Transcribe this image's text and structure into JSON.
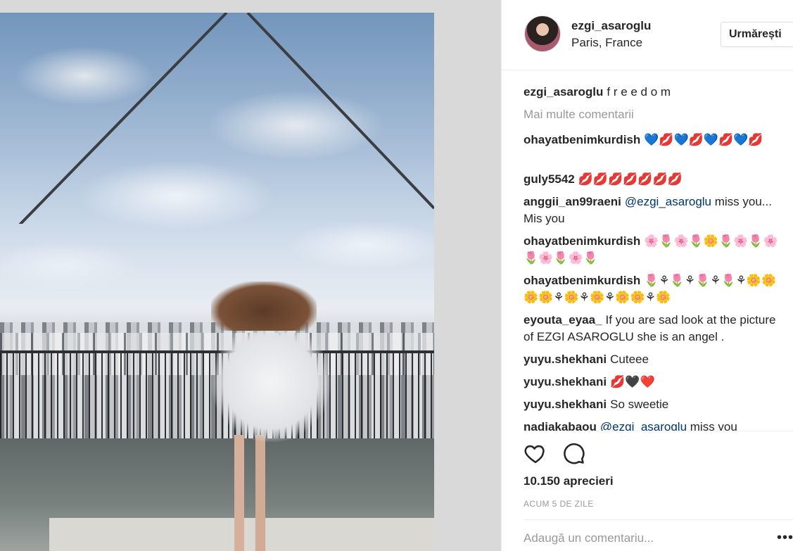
{
  "post": {
    "username": "ezgi_asaroglu",
    "location": "Paris, France",
    "follow_label": "Urmărești",
    "caption_user": "ezgi_asaroglu",
    "caption_text": "f r e e d o m",
    "more_comments": "Mai multe comentarii",
    "likes": "10.150 aprecieri",
    "time": "ACUM 5 DE ZILE",
    "add_comment_placeholder": "Adaugă un comentariu...",
    "options_label": "•••",
    "carousel": {
      "count": 2,
      "active": 2
    }
  },
  "comments": [
    {
      "user": "ohayatbenimkurdish",
      "text": "💙💋💙💋💙💋💙💋"
    },
    {
      "user": "guly5542",
      "text": "💋💋💋💋💋💋💋"
    },
    {
      "user": "anggii_an99raeni",
      "mention": "@ezgi_asaroglu",
      "text": " miss you... Mis you"
    },
    {
      "user": "ohayatbenimkurdish",
      "text": "🌸🌷🌸🌷🌼🌷🌸🌷🌸🌷🌸🌷🌸🌷"
    },
    {
      "user": "ohayatbenimkurdish",
      "text": "🌷⚘🌷⚘🌷⚘🌷⚘🌼🌼🌼🌼⚘🌼⚘🌼⚘🌼🌼⚘🌼"
    },
    {
      "user": "eyouta_eyaa_",
      "text": "If you are sad look at the picture of EZGI ASAROGLU she is an angel ."
    },
    {
      "user": "yuyu.shekhani",
      "text": "Cuteee"
    },
    {
      "user": "yuyu.shekhani",
      "text": "💋🖤❤️"
    },
    {
      "user": "yuyu.shekhani",
      "text": "So sweetie"
    },
    {
      "user": "nadiakabaou",
      "mention": "@ezgi_asaroglu",
      "text": " miss you"
    }
  ]
}
